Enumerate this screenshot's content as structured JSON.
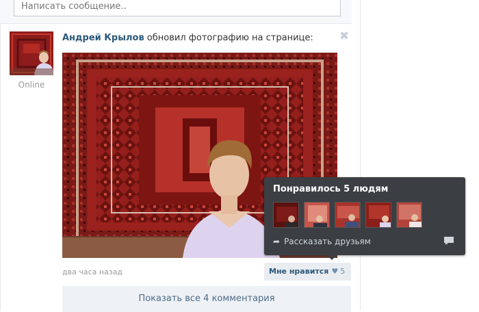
{
  "composer": {
    "placeholder": "Написать сообщение.."
  },
  "post": {
    "author": "Андрей Крылов",
    "action": " обновил фотографию на странице:",
    "status": "Online",
    "time": "два часа назад",
    "like_label": "Мне нравится",
    "like_count": "5",
    "show_comments": "Показать все 4 комментария"
  },
  "likes_popup": {
    "title": "Понравилось 5 людям",
    "share_label": "Рассказать друзьям",
    "thumbnails": [
      "liker-1",
      "liker-2",
      "liker-3",
      "liker-4",
      "liker-5"
    ]
  },
  "colors": {
    "link": "#2b587a",
    "popup_bg": "#3b3f44",
    "button_bg": "#e9edf1"
  },
  "icons": [
    "close-icon",
    "heart-icon",
    "share-icon",
    "comment-icon"
  ]
}
